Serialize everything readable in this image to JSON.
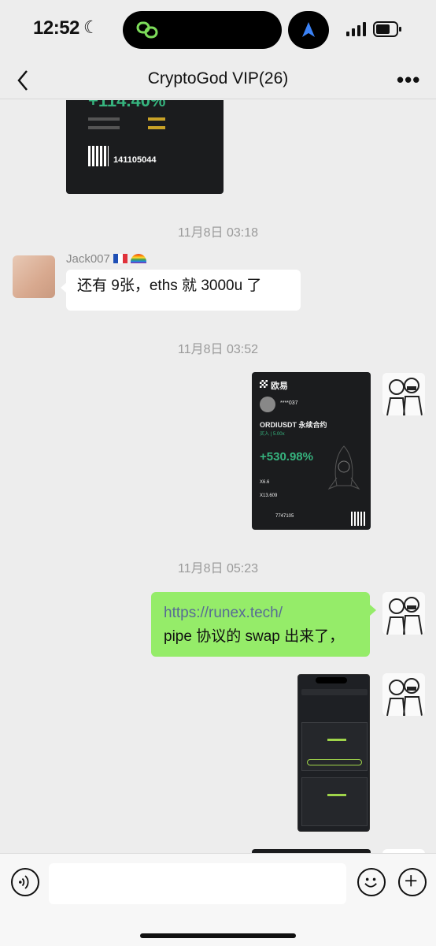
{
  "status_bar": {
    "time": "12:52"
  },
  "header": {
    "title": "CryptoGod VIP(26)"
  },
  "top_card": {
    "percent": "+114.40%",
    "code": "141105044"
  },
  "timestamps": [
    "11月8日 03:18",
    "11月8日 03:52",
    "11月8日 05:23"
  ],
  "msg1": {
    "sender": "Jack007",
    "text": "还有 9张，eths 就 3000u 了"
  },
  "pnl_card": {
    "brand": "欧易",
    "user": "****037",
    "pair": "ORDIUSDT 永续合约",
    "side": "买入 | 5.00x",
    "pnl": "+530.98%",
    "open_price": "X6.6",
    "mark_price": "X13.609",
    "invite_code": "7747105"
  },
  "msg2": {
    "link": "https://runex.tech/",
    "text": "pipe 协议的 swap 出来了，"
  },
  "colors": {
    "bubble_out": "#95ec69",
    "bubble_in": "#ffffff",
    "link": "#576b95",
    "bg": "#ededed"
  }
}
